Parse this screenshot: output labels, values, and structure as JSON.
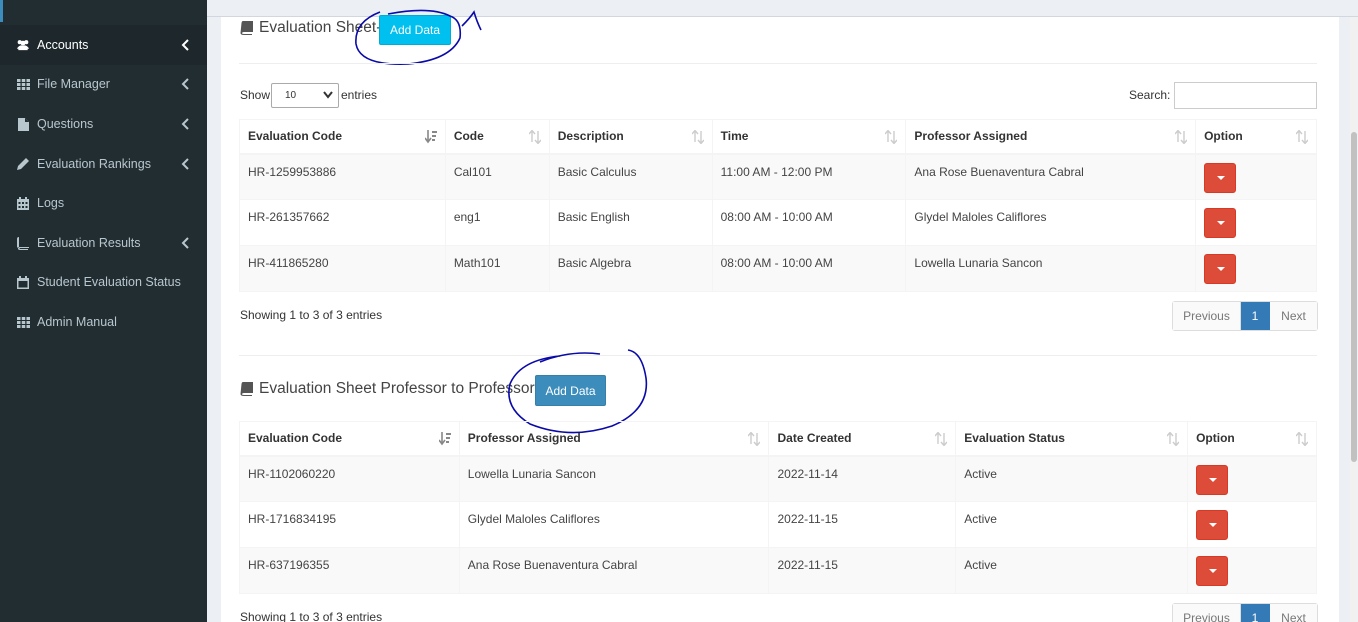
{
  "sidebar": {
    "items": [
      {
        "label": "Accounts",
        "icon": "users-icon",
        "chevron": true
      },
      {
        "label": "File Manager",
        "icon": "grid-icon",
        "chevron": true
      },
      {
        "label": "Questions",
        "icon": "file-icon",
        "chevron": true
      },
      {
        "label": "Evaluation Rankings",
        "icon": "pencil-icon",
        "chevron": true
      },
      {
        "label": "Logs",
        "icon": "calendar-grid-icon",
        "chevron": false
      },
      {
        "label": "Evaluation Results",
        "icon": "book-icon",
        "chevron": true
      },
      {
        "label": "Student Evaluation Status",
        "icon": "calendar-icon",
        "chevron": false
      },
      {
        "label": "Admin Manual",
        "icon": "grid-icon",
        "chevron": false
      }
    ]
  },
  "sheet1": {
    "title": "Evaluation Sheet-",
    "add_label": "Add Data",
    "show_label": "Show",
    "entries_value": "10",
    "entries_label": "entries",
    "search_label": "Search:",
    "search_value": "",
    "columns": [
      "Evaluation Code",
      "Code",
      "Description",
      "Time",
      "Professor Assigned",
      "Option"
    ],
    "rows": [
      [
        "HR-1259953886",
        "Cal101",
        "Basic Calculus",
        "11:00 AM - 12:00 PM",
        "Ana Rose Buenaventura Cabral"
      ],
      [
        "HR-261357662",
        "eng1",
        "Basic English",
        "08:00 AM - 10:00 AM",
        "Glydel Maloles Califlores"
      ],
      [
        "HR-411865280",
        "Math101",
        "Basic Algebra",
        "08:00 AM - 10:00 AM",
        "Lowella Lunaria Sancon"
      ]
    ],
    "info": "Showing 1 to 3 of 3 entries",
    "pager": {
      "previous": "Previous",
      "current": "1",
      "next": "Next"
    }
  },
  "sheet2": {
    "title": "Evaluation Sheet Professor to Professor -",
    "add_label": "Add Data",
    "columns": [
      "Evaluation Code",
      "Professor Assigned",
      "Date Created",
      "Evaluation Status",
      "Option"
    ],
    "rows": [
      [
        "HR-1102060220",
        "Lowella Lunaria Sancon",
        "2022-11-14",
        "Active"
      ],
      [
        "HR-1716834195",
        "Glydel Maloles Califlores",
        "2022-11-15",
        "Active"
      ],
      [
        "HR-637196355",
        "Ana Rose Buenaventura Cabral",
        "2022-11-15",
        "Active"
      ]
    ],
    "info": "Showing 1 to 3 of 3 entries",
    "pager": {
      "previous": "Previous",
      "current": "1",
      "next": "Next"
    }
  },
  "colors": {
    "sidebar_bg": "#222d32",
    "btn_info": "#00c0ef",
    "btn_primary": "#3c8dbc",
    "btn_danger": "#dd4b39",
    "annotation_ink": "#0a0aa8"
  }
}
